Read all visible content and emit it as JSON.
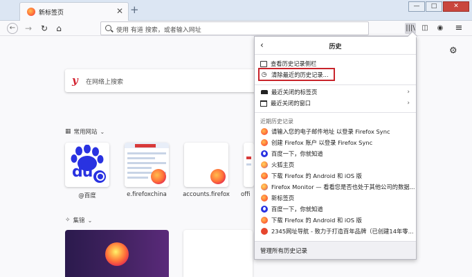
{
  "tab": {
    "title": "新标签页",
    "close": "✕"
  },
  "new_tab": "+",
  "window_buttons": {
    "min": "—",
    "max": "□",
    "close": "✕"
  },
  "toolbar": {
    "back": "←",
    "forward": "→",
    "reload": "↻",
    "home": "⌂",
    "url_placeholder": "使用 有道 搜索，或者输入网址",
    "library": "|||\\",
    "sidebar": "◫",
    "account": "◉",
    "menu": "≡"
  },
  "newtab": {
    "search_placeholder": "在网络上搜索",
    "search_logo": "y",
    "top_sites_label": "常用网站",
    "highlights_label": "集锦",
    "tiles": [
      {
        "label": "@百度"
      },
      {
        "label": "e.firefoxchina"
      },
      {
        "label": "accounts.firefox"
      },
      {
        "label": "offi"
      }
    ],
    "baidu_du": "du"
  },
  "history_panel": {
    "title": "历史",
    "back": "‹",
    "items_top": [
      {
        "label": "查看历史记录侧栏",
        "icon": "sidebar-icon"
      },
      {
        "label": "清除最近的历史记录...",
        "icon": "clock-icon"
      }
    ],
    "items_recent_closed": [
      {
        "label": "最近关闭的标签页",
        "icon": "tab-icon",
        "more": "›"
      },
      {
        "label": "最近关闭的窗口",
        "icon": "window-icon",
        "more": "›"
      }
    ],
    "recent_label": "近期历史记录",
    "recent": [
      {
        "label": "请输入您的电子邮件地址 以登录 Firefox Sync",
        "icon": "firefox-icon"
      },
      {
        "label": "创建 Firefox 账户 以登录 Firefox Sync",
        "icon": "firefox-icon"
      },
      {
        "label": "百度一下，你就知道",
        "icon": "baidu-icon"
      },
      {
        "label": "火狐主页",
        "icon": "firefox-china-icon"
      },
      {
        "label": "下载 Firefox 的 Android 和 iOS 版",
        "icon": "firefox-icon"
      },
      {
        "label": "Firefox Monitor — 看看您是否也处于其他公司的数据...",
        "icon": "firefox-icon"
      },
      {
        "label": "新标签页",
        "icon": "firefox-icon"
      },
      {
        "label": "百度一下，你就知道",
        "icon": "baidu-icon"
      },
      {
        "label": "下载 Firefox 的 Android 和 iOS 版",
        "icon": "firefox-icon"
      },
      {
        "label": "2345网址导航 - 致力于打造百年品牌（已创建14年零...",
        "icon": "site-2345-icon"
      }
    ],
    "footer": "管理所有历史记录"
  },
  "colors": {
    "highlight_box": "#c8232a",
    "accent": "#0a84ff"
  }
}
